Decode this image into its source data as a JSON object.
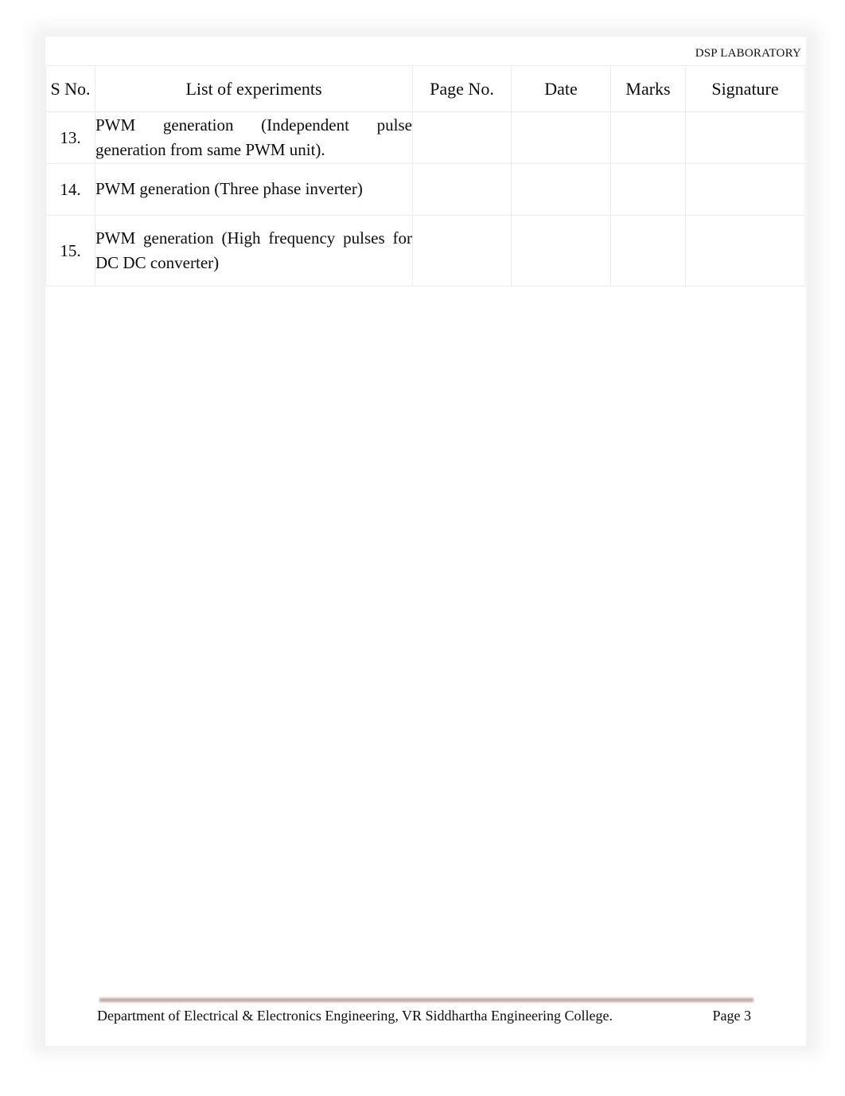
{
  "header": {
    "running_title": "DSP LABORATORY"
  },
  "table": {
    "columns": [
      {
        "key": "sno",
        "label": "S No."
      },
      {
        "key": "list",
        "label": "List of experiments"
      },
      {
        "key": "page_no",
        "label": "Page No."
      },
      {
        "key": "date",
        "label": "Date"
      },
      {
        "key": "marks",
        "label": "Marks"
      },
      {
        "key": "signature",
        "label": "Signature"
      }
    ],
    "rows": [
      {
        "sno": "13.",
        "experiment": "PWM generation (Independent pulse generation from same PWM unit).",
        "page_no": "",
        "date": "",
        "marks": "",
        "signature": ""
      },
      {
        "sno": "14.",
        "experiment": "PWM generation (Three phase inverter)",
        "page_no": "",
        "date": "",
        "marks": "",
        "signature": ""
      },
      {
        "sno": "15.",
        "experiment": "PWM generation (High frequency pulses for DC DC converter)",
        "page_no": "",
        "date": "",
        "marks": "",
        "signature": ""
      }
    ]
  },
  "footer": {
    "department": "Department of Electrical & Electronics Engineering, VR Siddhartha Engineering College.",
    "page_label": "Page 3",
    "rule_color": "#af9191"
  },
  "colors": {
    "page_background": "#ffffff",
    "canvas_background": "#f0f0f0",
    "table_border": "#ececec",
    "text": "#0d0d0d",
    "footer_rule": "#af9191"
  }
}
